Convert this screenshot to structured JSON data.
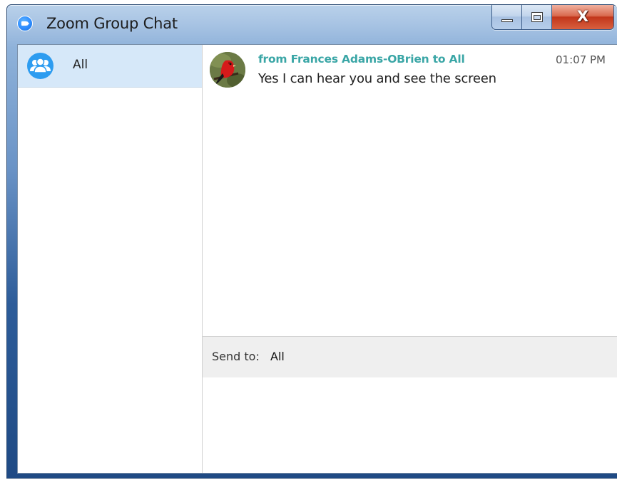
{
  "window": {
    "title": "Zoom Group Chat",
    "close_label": "X"
  },
  "sidebar": {
    "items": [
      {
        "label": "All",
        "icon": "group-icon",
        "selected": true
      }
    ]
  },
  "messages": [
    {
      "sender": "from Frances Adams-OBrien to All",
      "time": "01:07 PM",
      "text": "Yes I can hear you and see the screen",
      "avatar": "bird-avatar"
    }
  ],
  "composer": {
    "send_to_label": "Send to:",
    "send_to_value": "All",
    "input_value": ""
  },
  "colors": {
    "sender_name": "#3aa6a6",
    "selected_item_bg": "#d6e8f9",
    "group_avatar": "#2d9cf0",
    "sendto_bar_bg": "#efefef"
  }
}
